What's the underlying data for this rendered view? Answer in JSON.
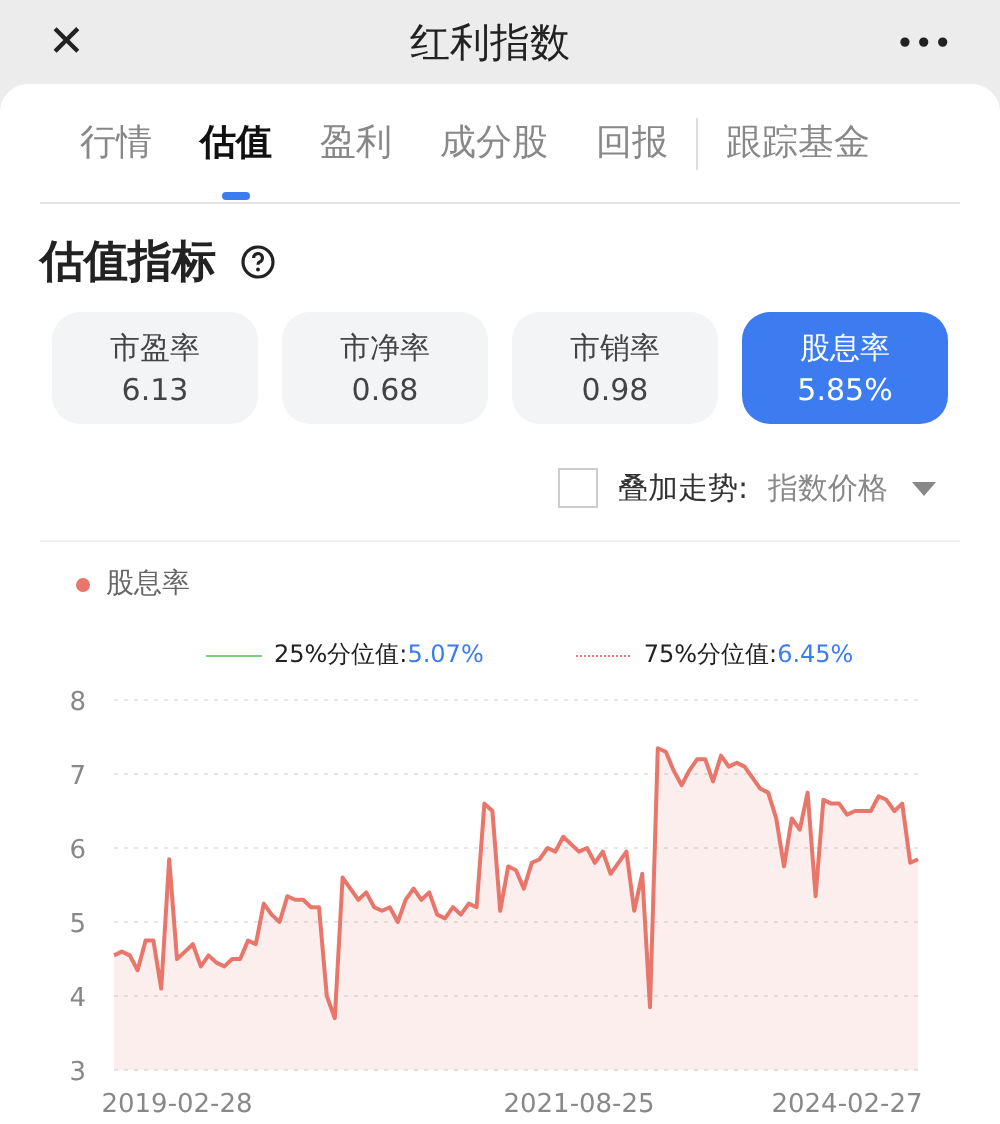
{
  "header": {
    "close": "✕",
    "title": "红利指数",
    "more": "•••"
  },
  "tabs": [
    {
      "label": "行情",
      "selected": false,
      "divider_before": false
    },
    {
      "label": "估值",
      "selected": true,
      "divider_before": false
    },
    {
      "label": "盈利",
      "selected": false,
      "divider_before": false
    },
    {
      "label": "成分股",
      "selected": false,
      "divider_before": false
    },
    {
      "label": "回报",
      "selected": false,
      "divider_before": false
    },
    {
      "label": "跟踪基金",
      "selected": false,
      "divider_before": true
    }
  ],
  "section_title": "估值指标",
  "metrics": [
    {
      "label": "市盈率",
      "value": "6.13",
      "selected": false
    },
    {
      "label": "市净率",
      "value": "0.68",
      "selected": false
    },
    {
      "label": "市销率",
      "value": "0.98",
      "selected": false
    },
    {
      "label": "股息率",
      "value": "5.85%",
      "selected": true
    }
  ],
  "overlay": {
    "checked": false,
    "label": "叠加走势:",
    "value": "指数价格"
  },
  "percentiles": [
    {
      "label": "25%分位值:",
      "value": "5.07%",
      "color": "#7ed07e",
      "kind": "solid"
    },
    {
      "label": "75%分位值:",
      "value": "6.45%",
      "color": "#e8766a",
      "kind": "dotted"
    }
  ],
  "chart_data": {
    "type": "area",
    "grid": true,
    "categories": [
      null,
      null,
      null,
      null,
      null,
      null,
      null,
      null,
      "2019-02-28",
      null,
      null,
      null,
      null,
      null,
      null,
      null,
      null,
      null,
      null,
      null,
      null,
      null,
      null,
      null,
      null,
      null,
      null,
      null,
      null,
      null,
      null,
      null,
      null,
      null,
      null,
      null,
      null,
      null,
      null,
      null,
      null,
      null,
      null,
      null,
      null,
      null,
      null,
      null,
      null,
      null,
      null,
      null,
      null,
      null,
      null,
      null,
      null,
      null,
      null,
      "2021-08-25",
      null,
      null,
      null,
      null,
      null,
      null,
      null,
      null,
      null,
      null,
      null,
      null,
      null,
      null,
      null,
      null,
      null,
      null,
      null,
      null,
      null,
      null,
      null,
      null,
      null,
      null,
      null,
      null,
      null,
      null,
      null,
      null,
      null,
      "2024-02-27",
      null,
      null,
      null,
      null,
      null,
      null,
      null,
      null,
      null
    ],
    "series": [
      {
        "name": "股息率",
        "color": "#e8766a",
        "values": [
          4.55,
          4.6,
          4.55,
          4.35,
          4.75,
          4.75,
          4.1,
          5.85,
          4.5,
          4.6,
          4.7,
          4.4,
          4.55,
          4.45,
          4.4,
          4.5,
          4.5,
          4.75,
          4.7,
          5.25,
          5.1,
          5.0,
          5.35,
          5.3,
          5.3,
          5.2,
          5.2,
          4.0,
          3.7,
          5.6,
          5.45,
          5.3,
          5.4,
          5.2,
          5.15,
          5.2,
          5.0,
          5.3,
          5.45,
          5.3,
          5.4,
          5.1,
          5.05,
          5.2,
          5.1,
          5.25,
          5.2,
          6.6,
          6.5,
          5.15,
          5.75,
          5.7,
          5.45,
          5.8,
          5.85,
          6.0,
          5.95,
          6.15,
          6.05,
          5.95,
          6.0,
          5.8,
          5.95,
          5.65,
          5.8,
          5.95,
          5.15,
          5.65,
          3.85,
          7.35,
          7.3,
          7.05,
          6.85,
          7.05,
          7.2,
          7.2,
          6.9,
          7.25,
          7.1,
          7.15,
          7.1,
          6.95,
          6.8,
          6.75,
          6.4,
          5.75,
          6.4,
          6.25,
          6.75,
          5.35,
          6.65,
          6.6,
          6.6,
          6.45,
          6.5,
          6.5,
          6.5,
          6.7,
          6.65,
          6.5,
          6.6,
          5.8,
          5.85
        ]
      }
    ],
    "ylim": [
      3,
      8
    ],
    "yticks": [
      3,
      4,
      5,
      6,
      7,
      8
    ]
  }
}
